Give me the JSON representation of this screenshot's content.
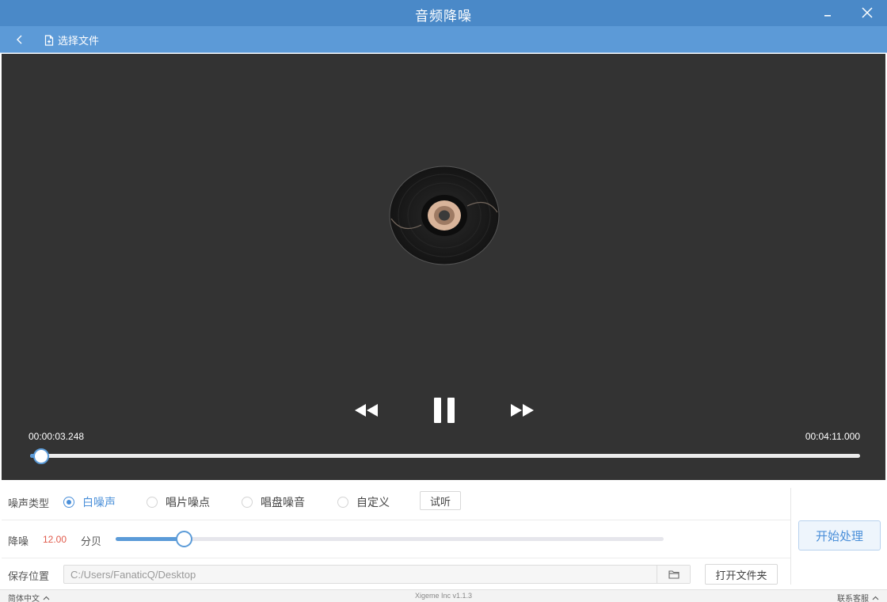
{
  "window": {
    "title": "音频降噪"
  },
  "toolbar": {
    "select_file_label": "选择文件"
  },
  "player": {
    "current_time": "00:00:03.248",
    "total_time": "00:04:11.000",
    "progress_fraction": 0.013
  },
  "noise_type": {
    "label": "噪声类型",
    "options": [
      {
        "label": "白噪声",
        "selected": true
      },
      {
        "label": "唱片噪点",
        "selected": false
      },
      {
        "label": "唱盘噪音",
        "selected": false
      },
      {
        "label": "自定义",
        "selected": false
      }
    ],
    "listen_button": "试听"
  },
  "denoise": {
    "label": "降噪",
    "value": "12.00",
    "unit": "分贝",
    "level_fraction": 0.124
  },
  "save": {
    "label": "保存位置",
    "path": "C:/Users/FanaticQ/Desktop",
    "open_folder_button": "打开文件夹"
  },
  "start_button": "开始处理",
  "statusbar": {
    "language": "简体中文",
    "version": "Xigeme Inc v1.1.3",
    "support": "联系客服"
  },
  "colors": {
    "titlebar": "#4a89c8",
    "toolbar": "#5c9ad7",
    "player_bg": "#333333",
    "accent": "#4a8fd9",
    "value_red": "#e05a4b"
  },
  "icons": {
    "back": "chevron-left-icon",
    "file": "file-add-icon",
    "minimize": "minimize-icon",
    "close": "close-icon",
    "rewind": "rewind-icon",
    "pause": "pause-icon",
    "fast_forward": "fast-forward-icon",
    "folder": "folder-icon",
    "vinyl": "vinyl-record-icon"
  }
}
